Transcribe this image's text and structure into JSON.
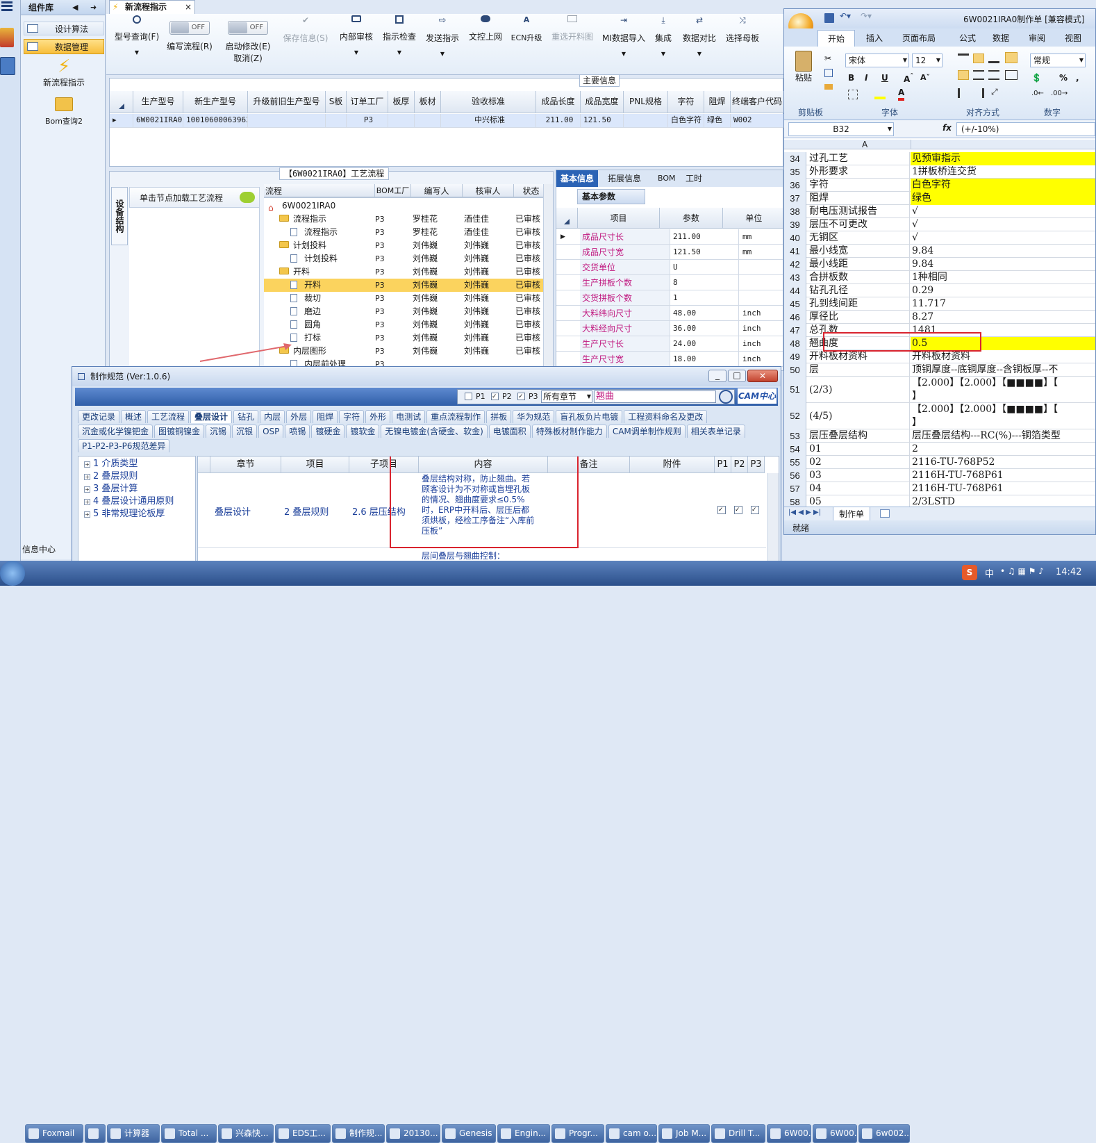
{
  "left_rail": {
    "group_label": "组件库",
    "items": [
      {
        "label": "设计算法"
      },
      {
        "label": "数据管理"
      },
      {
        "label": "新流程指示"
      },
      {
        "label": "Bom查询2"
      }
    ],
    "bottom_label": "信息中心"
  },
  "doc_tab": {
    "title": "新流程指示",
    "close": "×"
  },
  "toolbar": {
    "buttons": [
      {
        "label": "型号查询(F)"
      },
      {
        "label": "编写流程(R)",
        "toggle": "OFF"
      },
      {
        "label": "启动修改(E)",
        "sub": "取消(Z)",
        "toggle": "OFF"
      },
      {
        "label": "保存信息(S)"
      },
      {
        "label": "内部审核"
      },
      {
        "label": "指示检查"
      },
      {
        "label": "发送指示"
      },
      {
        "label": "文控上网"
      },
      {
        "label": "ECN升级"
      },
      {
        "label": "重选开料图"
      },
      {
        "label": "MI数据导入"
      },
      {
        "label": "集成"
      },
      {
        "label": "数据对比"
      },
      {
        "label": "选择母板"
      }
    ]
  },
  "main_info": {
    "title": "主要信息",
    "columns": [
      "生产型号",
      "新生产型号",
      "升级前旧生产型号",
      "S板",
      "订单工厂",
      "板厚",
      "板材",
      "验收标准",
      "成品长度",
      "成品宽度",
      "PNL规格",
      "字符",
      "阻焊",
      "终端客户代码"
    ],
    "row": [
      "6W0021IRA0",
      "10010600063963",
      "",
      "",
      "P3",
      "",
      "",
      "中兴标准",
      "211.00",
      "121.50",
      "",
      "白色字符",
      "绿色",
      "W002"
    ]
  },
  "process_panel": {
    "title": "【6W0021IRA0】工艺流程",
    "side_tab": "设备结构",
    "hint": "单击节点加载工艺流程",
    "columns": [
      "流程",
      "BOM工厂",
      "编写人",
      "核审人",
      "状态"
    ],
    "rows": [
      {
        "name": "6W0021IRA0",
        "factory": "",
        "writer": "",
        "reviewer": "",
        "status": "",
        "level": 0
      },
      {
        "name": "流程指示",
        "factory": "P3",
        "writer": "罗桂花",
        "reviewer": "酒佳佳",
        "status": "已审核",
        "level": 1
      },
      {
        "name": "流程指示",
        "factory": "P3",
        "writer": "罗桂花",
        "reviewer": "酒佳佳",
        "status": "已审核",
        "level": 2
      },
      {
        "name": "计划投料",
        "factory": "P3",
        "writer": "刘伟巍",
        "reviewer": "刘伟巍",
        "status": "已审核",
        "level": 1
      },
      {
        "name": "计划投料",
        "factory": "P3",
        "writer": "刘伟巍",
        "reviewer": "刘伟巍",
        "status": "已审核",
        "level": 2
      },
      {
        "name": "开料",
        "factory": "P3",
        "writer": "刘伟巍",
        "reviewer": "刘伟巍",
        "status": "已审核",
        "level": 1
      },
      {
        "name": "开料",
        "factory": "P3",
        "writer": "刘伟巍",
        "reviewer": "刘伟巍",
        "status": "已审核",
        "level": 2
      },
      {
        "name": "裁切",
        "factory": "P3",
        "writer": "刘伟巍",
        "reviewer": "刘伟巍",
        "status": "已审核",
        "level": 2
      },
      {
        "name": "磨边",
        "factory": "P3",
        "writer": "刘伟巍",
        "reviewer": "刘伟巍",
        "status": "已审核",
        "level": 2
      },
      {
        "name": "圆角",
        "factory": "P3",
        "writer": "刘伟巍",
        "reviewer": "刘伟巍",
        "status": "已审核",
        "level": 2
      },
      {
        "name": "打标",
        "factory": "P3",
        "writer": "刘伟巍",
        "reviewer": "刘伟巍",
        "status": "已审核",
        "level": 2
      },
      {
        "name": "内层图形",
        "factory": "P3",
        "writer": "刘伟巍",
        "reviewer": "刘伟巍",
        "status": "已审核",
        "level": 1
      },
      {
        "name": "内层前处理",
        "factory": "P3",
        "writer": "",
        "reviewer": "",
        "status": "",
        "level": 2
      }
    ]
  },
  "basic_info": {
    "tabs": [
      "基本信息",
      "拓展信息",
      "BOM",
      "工时"
    ],
    "sub_tab": "基本参数",
    "columns": [
      "项目",
      "参数",
      "单位"
    ],
    "rows": [
      {
        "name": "成品尺寸长",
        "value": "211.00",
        "unit": "mm"
      },
      {
        "name": "成品尺寸宽",
        "value": "121.50",
        "unit": "mm"
      },
      {
        "name": "交货单位",
        "value": "U",
        "unit": ""
      },
      {
        "name": "生产拼板个数",
        "value": "8",
        "unit": ""
      },
      {
        "name": "交货拼板个数",
        "value": "1",
        "unit": ""
      },
      {
        "name": "大料纬向尺寸",
        "value": "48.00",
        "unit": "inch"
      },
      {
        "name": "大料经向尺寸",
        "value": "36.00",
        "unit": "inch"
      },
      {
        "name": "生产尺寸长",
        "value": "24.00",
        "unit": "inch"
      },
      {
        "name": "生产尺寸宽",
        "value": "18.00",
        "unit": "inch"
      }
    ]
  },
  "excel": {
    "title": "6W0021IRA0制作单 [兼容模式]",
    "ribbon_tabs": [
      "开始",
      "插入",
      "页面布局",
      "公式",
      "数据",
      "审阅",
      "视图"
    ],
    "font_name": "宋体",
    "font_size": "12",
    "number_format": "常规",
    "paste_label": "粘贴",
    "groups": [
      "剪贴板",
      "字体",
      "对齐方式",
      "数字"
    ],
    "name_box": "B32",
    "formula": "(+/-10%)",
    "col_a": "A",
    "rows": [
      {
        "n": "34",
        "a": "过孔工艺",
        "b": "见预审指示",
        "hl": true
      },
      {
        "n": "35",
        "a": "外形要求",
        "b": "1拼板桥连交货",
        "hl": false
      },
      {
        "n": "36",
        "a": "字符",
        "b": "白色字符",
        "hl": true
      },
      {
        "n": "37",
        "a": "阻焊",
        "b": "绿色",
        "hl": true
      },
      {
        "n": "38",
        "a": "耐电压测试报告",
        "b": "√",
        "hl": false
      },
      {
        "n": "39",
        "a": "层压不可更改",
        "b": "√",
        "hl": false
      },
      {
        "n": "40",
        "a": "无铜区",
        "b": "√",
        "hl": false
      },
      {
        "n": "41",
        "a": "最小线宽",
        "b": "9.84",
        "hl": false
      },
      {
        "n": "42",
        "a": "最小线距",
        "b": "9.84",
        "hl": false
      },
      {
        "n": "43",
        "a": "合拼板数",
        "b": "1种相同",
        "hl": false
      },
      {
        "n": "44",
        "a": "钻孔孔径",
        "b": "0.29",
        "hl": false
      },
      {
        "n": "45",
        "a": "孔到线间距",
        "b": "11.717",
        "hl": false
      },
      {
        "n": "46",
        "a": "厚径比",
        "b": "8.27",
        "hl": false
      },
      {
        "n": "47",
        "a": "总孔数",
        "b": "1481",
        "hl": false
      },
      {
        "n": "48",
        "a": "翘曲度",
        "b": "0.5",
        "hl": true
      },
      {
        "n": "49",
        "a": "开料板材资料",
        "b": "开料板材资料",
        "hl": false
      },
      {
        "n": "50",
        "a": "层",
        "b": "顶铜厚度--底铜厚度--含铜板厚--不",
        "hl": false
      },
      {
        "n": "51",
        "a": "(2/3)",
        "b": "【2.000】【2.000】【■■■■】【",
        "b2": "】",
        "hl": false,
        "tall": true
      },
      {
        "n": "52",
        "a": "(4/5)",
        "b": "【2.000】【2.000】【■■■■】【",
        "b2": "】",
        "hl": false,
        "tall": true
      },
      {
        "n": "53",
        "a": "层压叠层结构",
        "b": "层压叠层结构---RC(%)---铜箔类型",
        "hl": false
      },
      {
        "n": "54",
        "a": "01",
        "b": "2",
        "hl": false
      },
      {
        "n": "55",
        "a": "02",
        "b": "2116-TU-768P52",
        "hl": false
      },
      {
        "n": "56",
        "a": "03",
        "b": "2116H-TU-768P61",
        "hl": false
      },
      {
        "n": "57",
        "a": "04",
        "b": "2116H-TU-768P61",
        "hl": false
      },
      {
        "n": "58",
        "a": "05",
        "b": "2/3LSTD",
        "hl": false
      }
    ],
    "sheet_tab": "制作单",
    "status": "就绪"
  },
  "spec_dialog": {
    "title": "制作规范 (Ver:1.0.6)",
    "filters": [
      "P1",
      "P2",
      "P3"
    ],
    "chapter_select": "所有章节",
    "search_value": "翘曲",
    "logo": "CAM中心",
    "tabs_row1": [
      "更改记录",
      "概述",
      "工艺流程",
      "叠层设计",
      "钻孔",
      "内层",
      "外层",
      "阻焊",
      "字符",
      "外形",
      "电测试",
      "重点流程制作",
      "拼板",
      "华为规范",
      "盲孔板负片电镀",
      "工程资料命名及更改"
    ],
    "tabs_row2": [
      "沉金或化学镍钯金",
      "图镀铜镍金",
      "沉锡",
      "沉银",
      "OSP",
      "喷锡",
      "镀硬金",
      "镀软金",
      "无镍电镀金(含硬金、软金)",
      "电镀面积",
      "特殊板材制作能力",
      "CAM调单制作规则",
      "相关表单记录"
    ],
    "tabs_row3": [
      "P1-P2-P3-P6规范差异"
    ],
    "tree": [
      "1 介质类型",
      "2 叠层规则",
      "3 叠层计算",
      "4 叠层设计通用原则",
      "5 非常规理论板厚"
    ],
    "grid_columns": [
      "章节",
      "项目",
      "子项目",
      "内容",
      "备注",
      "附件",
      "P1",
      "P2",
      "P3"
    ],
    "grid_row": {
      "chapter": "叠层设计",
      "item": "2 叠层规则",
      "sub": "2.6 层压结构",
      "content": "叠层结构对称，防止翘曲。若顾客设计为不对称或盲埋孔板的情况、翘曲度要求≤0.5%时，ERP中开料后、层压后都须烘板，经检工序备注“入库前压板”",
      "note": "",
      "attach": ""
    },
    "next_row": "层间叠层与翘曲控制："
  },
  "taskbar": {
    "items": [
      "Foxmail",
      "",
      "计算器",
      "Total ...",
      "兴森快...",
      "EDS工...",
      "制作规...",
      "20130...",
      "Genesis",
      "Engin...",
      "Progr...",
      "cam o...",
      "Job M...",
      "Drill T...",
      "6W00...",
      "6W00...",
      "6w002..."
    ],
    "ime": "中",
    "time": "14:42"
  },
  "colors": {
    "accent": "#1e63b8",
    "highlight_red": "#d9232e",
    "excel_yellow": "#ffff00",
    "param_pink": "#c0187f"
  }
}
